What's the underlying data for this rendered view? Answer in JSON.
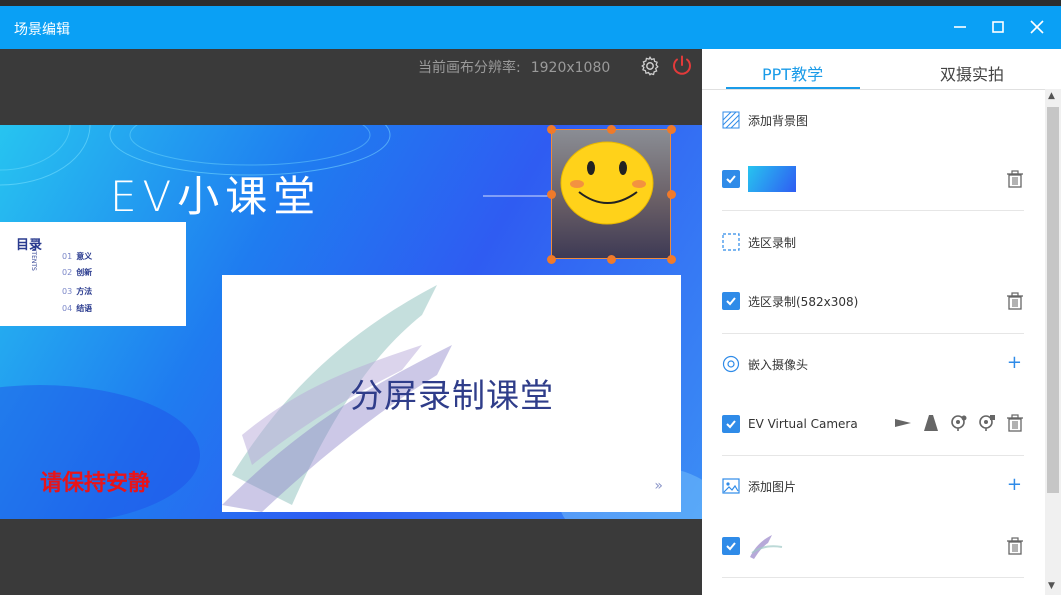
{
  "window": {
    "title": "场景编辑",
    "controls": [
      "minimize-icon",
      "maximize-icon",
      "close-icon"
    ],
    "accent_color": "#0aa0f5"
  },
  "canvas": {
    "resolution_label": "当前画布分辨率:",
    "resolution_value": "1920x1080",
    "icons": [
      "gear-icon",
      "power-icon"
    ]
  },
  "slide": {
    "title": "EV小课堂",
    "toc": {
      "heading": "目录",
      "heading_en": "CONTENTS",
      "items": [
        {
          "num": "01",
          "label": "意义"
        },
        {
          "num": "02",
          "label": "创新"
        },
        {
          "num": "03",
          "label": "方法"
        },
        {
          "num": "04",
          "label": "结语"
        }
      ]
    },
    "content_text": "分屏录制课堂",
    "content_arrow": "»",
    "notice": "请保持安静",
    "notice_color": "#e8141a"
  },
  "sidebar": {
    "tabs": [
      {
        "label": "PPT教学",
        "active": true
      },
      {
        "label": "双摄实拍",
        "active": false
      }
    ],
    "items": [
      {
        "type": "action",
        "icon": "background-image-icon",
        "label": "添加背景图"
      },
      {
        "type": "layer",
        "checked": true,
        "thumbnail": "slide-background-thumbnail",
        "label": ""
      },
      {
        "type": "action",
        "icon": "region-select-icon",
        "label": "选区录制"
      },
      {
        "type": "layer",
        "checked": true,
        "label": "选区录制(582x308)"
      },
      {
        "type": "action",
        "icon": "camera-embed-icon",
        "label": "嵌入摄像头"
      },
      {
        "type": "layer",
        "checked": true,
        "label": "EV Virtual Camera",
        "tools": [
          "flip-horizontal-icon",
          "flip-vertical-icon",
          "webcam-settings-icon",
          "webcam-adjust-icon"
        ]
      },
      {
        "type": "action",
        "icon": "add-image-icon",
        "label": "添加图片"
      },
      {
        "type": "layer",
        "checked": true,
        "thumbnail": "brush-image-thumbnail",
        "label": ""
      }
    ]
  }
}
